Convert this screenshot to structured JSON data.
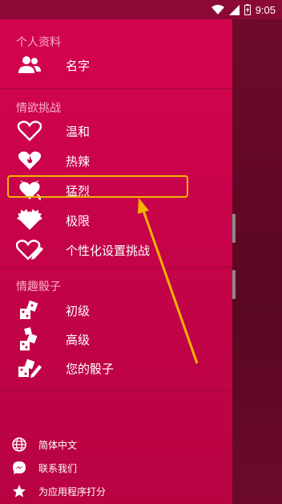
{
  "status_bar": {
    "time": "9:05"
  },
  "profile": {
    "section_title": "个人资料",
    "name_item": {
      "label": "名字",
      "icon": "people-icon"
    }
  },
  "challenges": {
    "section_title": "情欲挑战",
    "items": [
      {
        "label": "温和",
        "icon": "heart-outline-icon"
      },
      {
        "label": "热辣",
        "icon": "heart-flame-icon"
      },
      {
        "label": "猛烈",
        "icon": "heart-devil-icon"
      },
      {
        "label": "极限",
        "icon": "heart-spiky-icon"
      },
      {
        "label": "个性化设置挑战",
        "icon": "heart-edit-icon"
      }
    ]
  },
  "dice": {
    "section_title": "情趣骰子",
    "items": [
      {
        "label": "初级",
        "icon": "dice-basic-icon"
      },
      {
        "label": "高级",
        "icon": "dice-advanced-icon"
      },
      {
        "label": "您的骰子",
        "icon": "dice-edit-icon"
      }
    ]
  },
  "footer": {
    "items": [
      {
        "label": "简体中文",
        "icon": "globe-icon"
      },
      {
        "label": "联系我们",
        "icon": "messenger-icon"
      },
      {
        "label": "为应用程序打分",
        "icon": "star-icon"
      }
    ]
  },
  "colors": {
    "drawer_top": "#d4044f",
    "drawer_bottom": "#b80343",
    "highlight": "#f5b400",
    "section_title": "#f7b0c8"
  }
}
